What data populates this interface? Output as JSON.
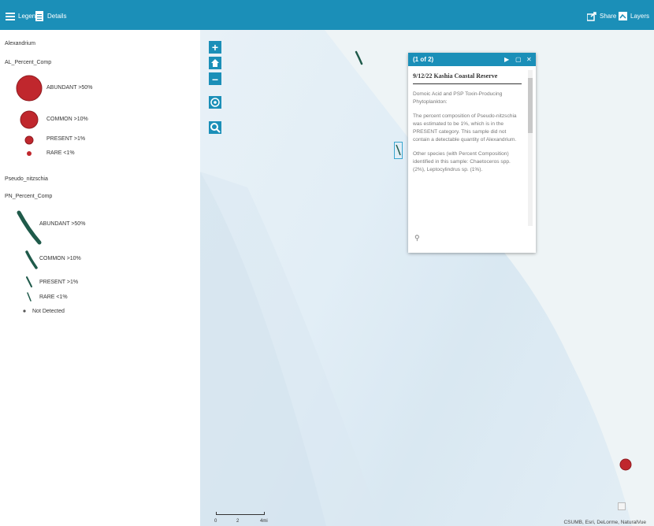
{
  "toolbar": {
    "legend_label": "Legend",
    "details_label": "Details",
    "share_label": "Share",
    "layers_label": "Layers"
  },
  "legend": {
    "section1_title": "Alexandrium",
    "section1_field": "AL_Percent_Comp",
    "section1_items": [
      "ABUNDANT >50%",
      "COMMON >10%",
      "PRESENT >1%",
      "RARE <1%"
    ],
    "section2_title": "Pseudo_nitzschia",
    "section2_field": "PN_Percent_Comp",
    "section2_items": [
      "ABUNDANT >50%",
      "COMMON >10%",
      "PRESENT >1%",
      "RARE <1%"
    ],
    "not_detected": "Not Detected"
  },
  "popup": {
    "count": "(1 of 2)",
    "title": "9/12/22 Kashia Coastal Reserve",
    "para1": "Domoic Acid and PSP Toxin-Producing Phytoplankton:",
    "para2": "The percent composition of Pseudo-nitzschia was estimated to be 1%, which is in the PRESENT category. This sample did not contain a detectable quantity of Alexandrium.",
    "para3": "Other species (with Percent Composition) identified in this sample: Chaetoceros spp. (2%), Leptocylindrus sp. (1%)."
  },
  "map": {
    "scale_labels": [
      "0",
      "2",
      "4mi"
    ],
    "attribution": "CSUMB, Esri, DeLorme, NaturalVue"
  },
  "colors": {
    "accent": "#1b8fb8",
    "alexandrium": "#c0272d",
    "pseudo_nitzschia": "#1f5a4a"
  }
}
